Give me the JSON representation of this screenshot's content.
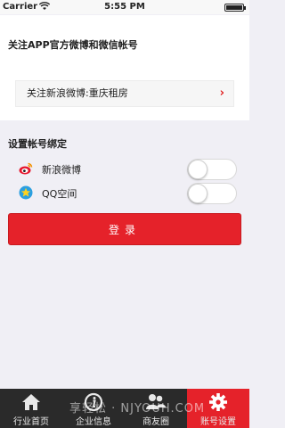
{
  "status_bar": {
    "carrier": "Carrier",
    "time": "5:55 PM"
  },
  "follow_section": {
    "title": "关注APP官方微博和微信帐号",
    "row_label": "关注新浪微博:重庆租房"
  },
  "bind_section": {
    "title": "设置帐号绑定",
    "accounts": [
      {
        "label": "新浪微博",
        "icon": "weibo-icon",
        "enabled": false
      },
      {
        "label": "QQ空间",
        "icon": "qzone-icon",
        "enabled": false
      }
    ],
    "login_label": "登录"
  },
  "tabbar": {
    "items": [
      {
        "label": "行业首页",
        "icon": "home-icon"
      },
      {
        "label": "企业信息",
        "icon": "info-icon"
      },
      {
        "label": "商友圈",
        "icon": "friends-icon"
      },
      {
        "label": "账号设置",
        "icon": "gear-icon",
        "active": true
      }
    ],
    "watermark": "享轻松 · NJYOUH.COM"
  },
  "colors": {
    "accent": "#e5222a",
    "tabbar": "#2a2a2a",
    "background": "#f0eff5"
  }
}
